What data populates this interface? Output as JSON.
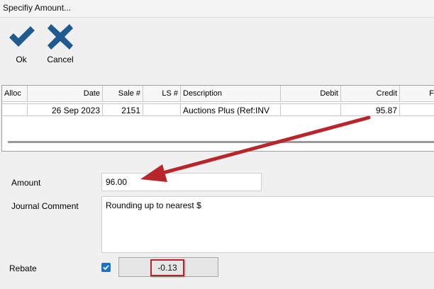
{
  "window": {
    "title": "Specifiy Amount..."
  },
  "toolbar": {
    "ok_label": "Ok",
    "cancel_label": "Cancel"
  },
  "table": {
    "columns": [
      "Alloc",
      "Date",
      "Sale #",
      "LS #",
      "Description",
      "Debit",
      "Credit",
      "F"
    ],
    "rows": [
      {
        "alloc": "",
        "date": "26 Sep 2023",
        "sale": "2151",
        "ls": "",
        "description": "Auctions Plus (Ref:INV",
        "debit": "",
        "credit": "95.87"
      }
    ]
  },
  "form": {
    "amount_label": "Amount",
    "amount_value": "96.00",
    "comment_label": "Journal Comment",
    "comment_value": "Rounding up to nearest $",
    "rebate_label": "Rebate",
    "rebate_checked": true,
    "rebate_value": "-0.13"
  },
  "colors": {
    "icon_blue": "#1f5b8f",
    "highlight_red": "#b8262b",
    "checkbox_blue": "#1a73c9"
  }
}
